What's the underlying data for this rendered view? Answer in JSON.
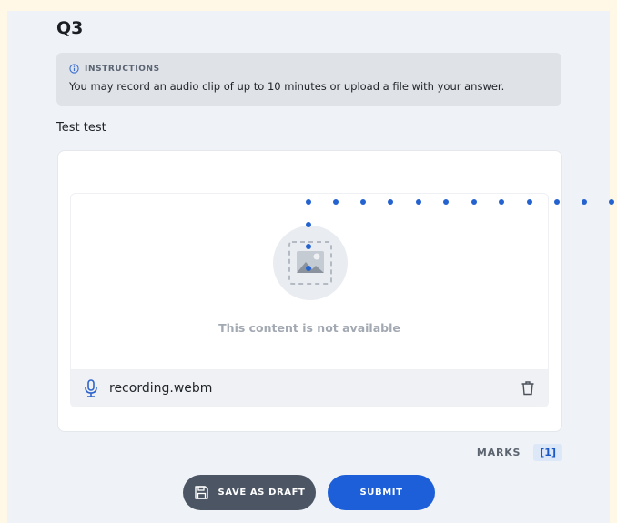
{
  "question": {
    "title": "Q3"
  },
  "instructions": {
    "label": "INSTRUCTIONS",
    "text": "You may record an audio clip of up to 10 minutes or upload a file with your answer.",
    "icon": "info-icon"
  },
  "prompt": "Test test",
  "media": {
    "unavailable_text": "This content is not available",
    "placeholder_icon": "image-placeholder-icon"
  },
  "recording": {
    "file_name": "recording.webm",
    "icon": "microphone-icon",
    "delete_icon": "trash-icon"
  },
  "marks": {
    "label": "MARKS",
    "value": "[1]"
  },
  "actions": {
    "save_draft": "SAVE AS DRAFT",
    "submit": "SUBMIT"
  },
  "colors": {
    "accent": "#1c5fd8",
    "draft_button": "#4b5563",
    "background": "#eff2f6",
    "highlight": "#fff8e6"
  }
}
